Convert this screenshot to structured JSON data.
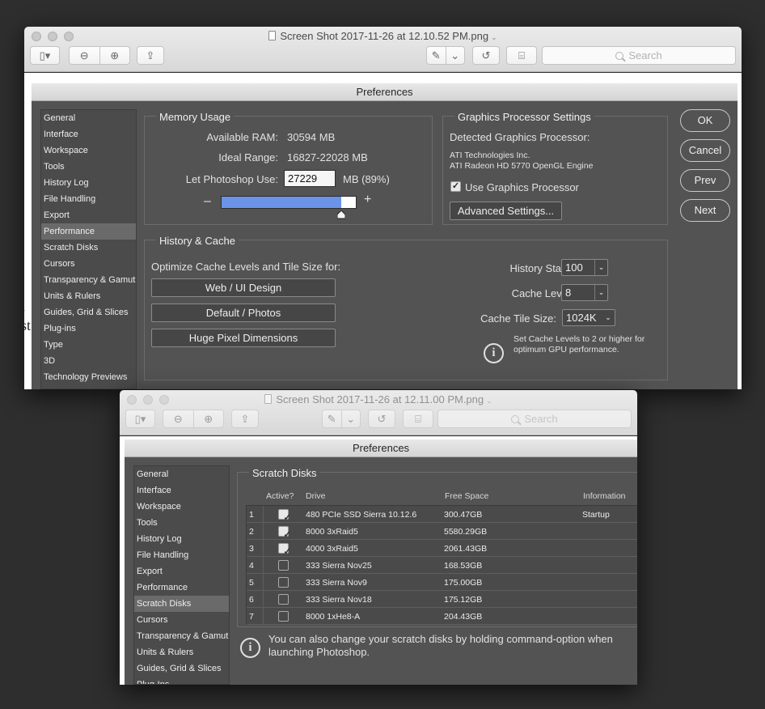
{
  "window1": {
    "title": "Screen Shot 2017-11-26 at 12.10.52 PM.png",
    "search_placeholder": "Search",
    "dialog_title": "Preferences",
    "nav": [
      {
        "label": "General",
        "selected": false
      },
      {
        "label": "Interface",
        "selected": false
      },
      {
        "label": "Workspace",
        "selected": false
      },
      {
        "label": "Tools",
        "selected": false
      },
      {
        "label": "History Log",
        "selected": false
      },
      {
        "label": "File Handling",
        "selected": false
      },
      {
        "label": "Export",
        "selected": false
      },
      {
        "label": "Performance",
        "selected": true
      },
      {
        "label": "Scratch Disks",
        "selected": false
      },
      {
        "label": "Cursors",
        "selected": false
      },
      {
        "label": "Transparency & Gamut",
        "selected": false
      },
      {
        "label": "Units & Rulers",
        "selected": false
      },
      {
        "label": "Guides, Grid & Slices",
        "selected": false
      },
      {
        "label": "Plug-ins",
        "selected": false
      },
      {
        "label": "Type",
        "selected": false
      },
      {
        "label": "3D",
        "selected": false
      },
      {
        "label": "Technology Previews",
        "selected": false
      }
    ],
    "memory": {
      "title": "Memory Usage",
      "available_label": "Available RAM:",
      "available_value": "30594 MB",
      "ideal_label": "Ideal Range:",
      "ideal_value": "16827-22028 MB",
      "use_label": "Let Photoshop Use:",
      "use_value": "27229",
      "use_suffix": "MB (89%)",
      "minus": "–",
      "plus": "+",
      "slider_fraction": 0.89
    },
    "gpu": {
      "title": "Graphics Processor Settings",
      "detected_label": "Detected Graphics Processor:",
      "vendor": "ATI Technologies Inc.",
      "model": "ATI Radeon HD 5770 OpenGL Engine",
      "use_gpu_label": "Use Graphics Processor",
      "use_gpu_checked": true,
      "advanced_button": "Advanced Settings..."
    },
    "history": {
      "title": "History & Cache",
      "optimize_label": "Optimize Cache Levels and Tile Size for:",
      "buttons": [
        "Web / UI Design",
        "Default / Photos",
        "Huge Pixel Dimensions"
      ],
      "states_label": "History States:",
      "states_value": "100",
      "levels_label": "Cache Levels:",
      "levels_value": "8",
      "tile_label": "Cache Tile Size:",
      "tile_value": "1024K",
      "tip_line1": "Set Cache Levels to 2 or higher for",
      "tip_line2": "optimum GPU performance."
    },
    "actions": {
      "ok": "OK",
      "cancel": "Cancel",
      "prev": "Prev",
      "next": "Next"
    },
    "doc_fragment1": "ı",
    "doc_fragment2": "st"
  },
  "window2": {
    "title": "Screen Shot 2017-11-26 at 12.11.00 PM.png",
    "search_placeholder": "Search",
    "dialog_title": "Preferences",
    "nav": [
      {
        "label": "General",
        "selected": false
      },
      {
        "label": "Interface",
        "selected": false
      },
      {
        "label": "Workspace",
        "selected": false
      },
      {
        "label": "Tools",
        "selected": false
      },
      {
        "label": "History Log",
        "selected": false
      },
      {
        "label": "File Handling",
        "selected": false
      },
      {
        "label": "Export",
        "selected": false
      },
      {
        "label": "Performance",
        "selected": false
      },
      {
        "label": "Scratch Disks",
        "selected": true
      },
      {
        "label": "Cursors",
        "selected": false
      },
      {
        "label": "Transparency & Gamut",
        "selected": false
      },
      {
        "label": "Units & Rulers",
        "selected": false
      },
      {
        "label": "Guides, Grid & Slices",
        "selected": false
      },
      {
        "label": "Plug-Ins",
        "selected": false
      }
    ],
    "scratch": {
      "title": "Scratch Disks",
      "headers": {
        "active": "Active?",
        "drive": "Drive",
        "free": "Free Space",
        "info": "Information"
      },
      "rows": [
        {
          "num": "1",
          "active": true,
          "drive": "480 PCIe SSD Sierra 10.12.6",
          "free": "300.47GB",
          "info": "Startup"
        },
        {
          "num": "2",
          "active": true,
          "drive": "8000 3xRaid5",
          "free": "5580.29GB",
          "info": ""
        },
        {
          "num": "3",
          "active": true,
          "drive": "4000 3xRaid5",
          "free": "2061.43GB",
          "info": ""
        },
        {
          "num": "4",
          "active": false,
          "drive": "333 Sierra Nov25",
          "free": "168.53GB",
          "info": ""
        },
        {
          "num": "5",
          "active": false,
          "drive": "333 Sierra Nov9",
          "free": "175.00GB",
          "info": ""
        },
        {
          "num": "6",
          "active": false,
          "drive": "333 Sierra Nov18",
          "free": "175.12GB",
          "info": ""
        },
        {
          "num": "7",
          "active": false,
          "drive": "8000 1xHe8-A",
          "free": "204.43GB",
          "info": ""
        }
      ],
      "tip_line1": "You can also change your scratch disks by holding command-option when",
      "tip_line2": "launching Photoshop."
    }
  },
  "colors": {
    "slider_fill": "#6b93e8",
    "panel": "#535353",
    "selected_nav": "#6a6a6a"
  }
}
